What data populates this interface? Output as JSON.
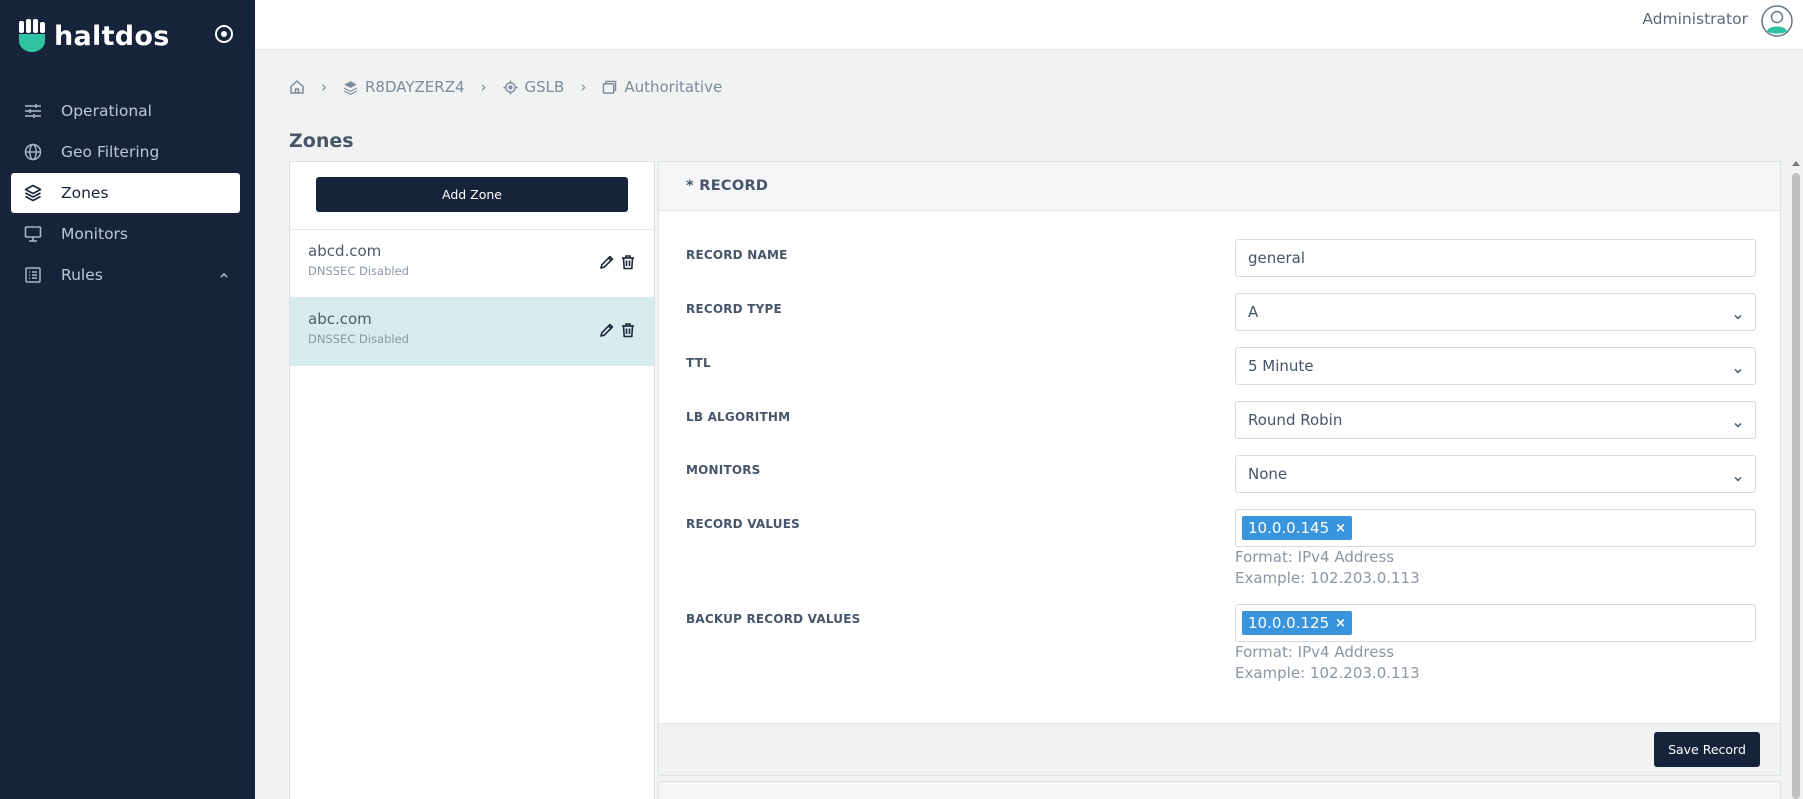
{
  "brand": {
    "name": "haltdos"
  },
  "sidebar": {
    "items": [
      {
        "label": "Operational",
        "icon": "sliders-icon",
        "active": false
      },
      {
        "label": "Geo Filtering",
        "icon": "globe-icon",
        "active": false
      },
      {
        "label": "Zones",
        "icon": "layers-icon",
        "active": true
      },
      {
        "label": "Monitors",
        "icon": "monitor-icon",
        "active": false
      },
      {
        "label": "Rules",
        "icon": "list-icon",
        "active": false,
        "expandable": true
      }
    ]
  },
  "header": {
    "user_name": "Administrator"
  },
  "breadcrumb": [
    {
      "label": "",
      "icon": "home-icon"
    },
    {
      "label": "R8DAYZERZ4",
      "icon": "layers-icon"
    },
    {
      "label": "GSLB",
      "icon": "target-icon"
    },
    {
      "label": "Authoritative",
      "icon": "window-icon"
    }
  ],
  "page": {
    "title": "Zones"
  },
  "zones": {
    "add_label": "Add Zone",
    "items": [
      {
        "name": "abcd.com",
        "status": "DNSSEC Disabled",
        "selected": false
      },
      {
        "name": "abc.com",
        "status": "DNSSEC Disabled",
        "selected": true
      }
    ]
  },
  "record": {
    "title": "* RECORD",
    "fields": {
      "name": {
        "label": "RECORD NAME",
        "value": "general"
      },
      "type": {
        "label": "RECORD TYPE",
        "value": "A"
      },
      "ttl": {
        "label": "TTL",
        "value": "5 Minute"
      },
      "lb": {
        "label": "LB ALGORITHM",
        "value": "Round Robin"
      },
      "monitors": {
        "label": "MONITORS",
        "value": "None"
      },
      "values": {
        "label": "RECORD VALUES",
        "tag": "10.0.0.145",
        "format": "Format: IPv4 Address",
        "example": "Example: 102.203.0.113"
      },
      "backup": {
        "label": "BACKUP RECORD VALUES",
        "tag": "10.0.0.125",
        "format": "Format: IPv4 Address",
        "example": "Example: 102.203.0.113"
      }
    },
    "save_label": "Save Record"
  },
  "colors": {
    "sidebar": "#17223b",
    "accent_tag": "#3894dc",
    "selected_row": "#d7eced",
    "brand_mark": "#2fc3a4"
  }
}
